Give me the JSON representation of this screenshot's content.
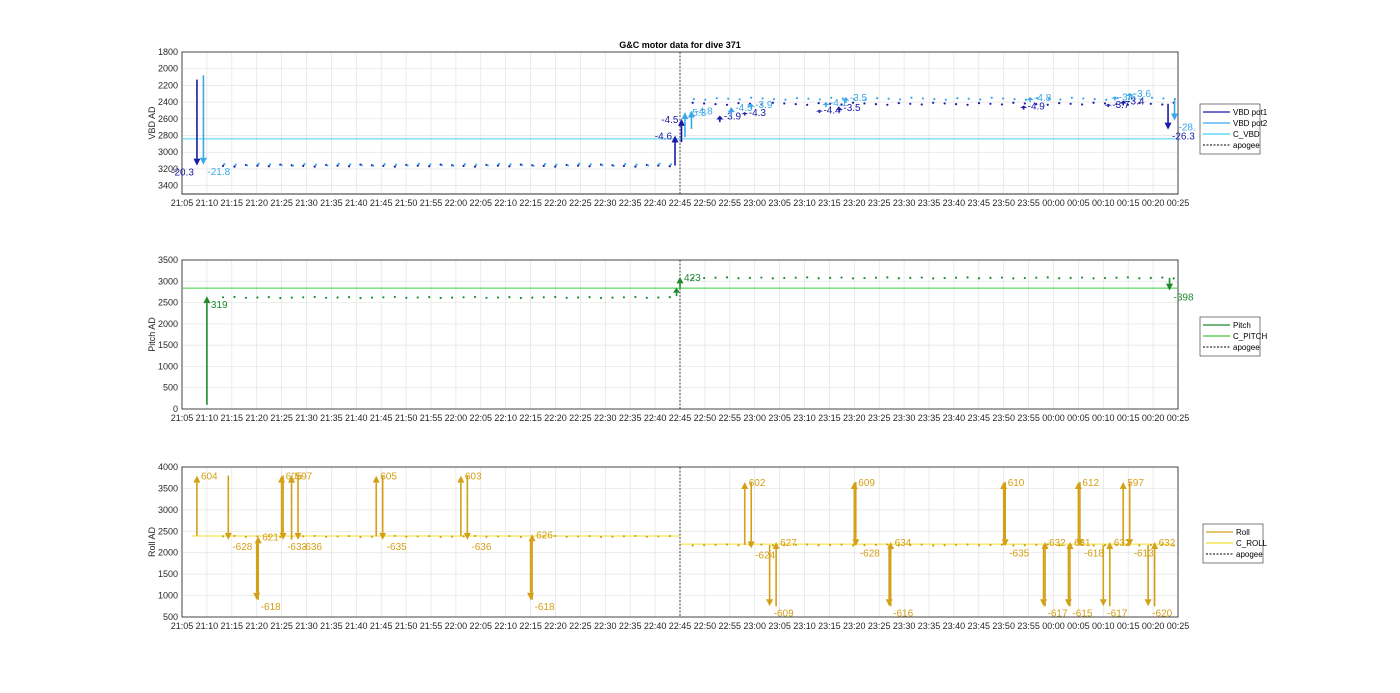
{
  "colors": {
    "vbd1": "#1a1aa6",
    "vbd2": "#38a8e8",
    "cvbd": "#45d0f0",
    "pitch": "#1e8a2e",
    "cpitch": "#3dcc3d",
    "roll": "#d4a017",
    "croll": "#f0e030",
    "apogee": "#333333"
  },
  "chart_data": [
    {
      "type": "scatter",
      "title": "G&C motor data for dive 371",
      "ylabel": "VBD AD",
      "y_reversed": true,
      "ylim": [
        1800,
        3500
      ],
      "yticks": [
        "1800",
        "2000",
        "2200",
        "2400",
        "2600",
        "2800",
        "3000",
        "3200",
        "3400"
      ],
      "xlim": [
        "21:05",
        "00:25"
      ],
      "xticks": [
        "21:05",
        "21:10",
        "21:15",
        "21:20",
        "21:25",
        "21:30",
        "21:35",
        "21:40",
        "21:45",
        "21:50",
        "21:55",
        "22:00",
        "22:05",
        "22:10",
        "22:15",
        "22:20",
        "22:25",
        "22:30",
        "22:35",
        "22:40",
        "22:45",
        "22:50",
        "22:55",
        "23:00",
        "23:05",
        "23:10",
        "23:15",
        "23:20",
        "23:25",
        "23:30",
        "23:35",
        "23:40",
        "23:45",
        "23:50",
        "23:55",
        "00:00",
        "00:05",
        "00:10",
        "00:15",
        "00:20",
        "00:25"
      ],
      "grid": true,
      "legend": {
        "position": "outside-right",
        "entries": [
          "VBD pot1",
          "VBD pot2",
          "C_VBD",
          "apogee"
        ]
      },
      "apogee": "22:45",
      "series": [
        {
          "name": "C_VBD",
          "kind": "hline",
          "y": 2840
        },
        {
          "name": "VBD pot1",
          "kind": "points",
          "base_dive": 3160,
          "base_climb": 2420
        },
        {
          "name": "VBD pot2",
          "kind": "points",
          "base_dive": 3150,
          "base_climb": 2360
        }
      ],
      "arrows": [
        {
          "t": "21:08",
          "y0": 2130,
          "y1": 3160,
          "color": "vbd1",
          "label": "-20.3"
        },
        {
          "t": "21:09",
          "y0": 2080,
          "y1": 3150,
          "color": "vbd2",
          "label": "-21.8"
        },
        {
          "t": "22:44",
          "y0": 3160,
          "y1": 2800,
          "color": "vbd1",
          "label": "-4.6"
        },
        {
          "t": "22:45",
          "y0": 2880,
          "y1": 2600,
          "color": "vbd1",
          "label": "-4.5"
        },
        {
          "t": "22:46",
          "y0": 2820,
          "y1": 2520,
          "color": "vbd2",
          "label": "-5.3"
        },
        {
          "t": "22:47",
          "y0": 2720,
          "y1": 2500,
          "color": "vbd2",
          "label": "-4.8"
        },
        {
          "t": "22:53",
          "y0": 2640,
          "y1": 2560,
          "color": "vbd1",
          "label": "-3.9"
        },
        {
          "t": "22:55",
          "y0": 2560,
          "y1": 2460,
          "color": "vbd2",
          "label": "-4.5"
        },
        {
          "t": "22:58",
          "y0": 2560,
          "y1": 2520,
          "color": "vbd1",
          "label": "-4.3"
        },
        {
          "t": "22:59",
          "y0": 2480,
          "y1": 2420,
          "color": "vbd2",
          "label": "-3.9"
        },
        {
          "t": "23:13",
          "y0": 2530,
          "y1": 2490,
          "color": "vbd1",
          "label": "-4.4"
        },
        {
          "t": "23:14",
          "y0": 2460,
          "y1": 2400,
          "color": "vbd2",
          "label": "-4.1"
        },
        {
          "t": "23:17",
          "y0": 2520,
          "y1": 2460,
          "color": "vbd1",
          "label": "-3.5"
        },
        {
          "t": "23:18",
          "y0": 2410,
          "y1": 2340,
          "color": "vbd2",
          "label": "-3.5"
        },
        {
          "t": "23:54",
          "y0": 2490,
          "y1": 2440,
          "color": "vbd1",
          "label": "-4.9"
        },
        {
          "t": "23:55",
          "y0": 2400,
          "y1": 2340,
          "color": "vbd2",
          "label": "-4.8"
        },
        {
          "t": "00:11",
          "y0": 2460,
          "y1": 2420,
          "color": "vbd1",
          "label": "-3.7"
        },
        {
          "t": "00:12",
          "y0": 2380,
          "y1": 2330,
          "color": "vbd2",
          "label": "-3.6"
        },
        {
          "t": "00:14",
          "y0": 2440,
          "y1": 2380,
          "color": "vbd1",
          "label": "-3.4"
        },
        {
          "t": "00:15",
          "y0": 2350,
          "y1": 2290,
          "color": "vbd2",
          "label": "-3.6"
        },
        {
          "t": "00:23",
          "y0": 2420,
          "y1": 2730,
          "color": "vbd1",
          "label": "-26.3"
        },
        {
          "t": "00:24",
          "y0": 2380,
          "y1": 2620,
          "color": "vbd2",
          "label": "-28."
        }
      ]
    },
    {
      "type": "scatter",
      "ylabel": "Pitch AD",
      "ylim": [
        0,
        3500
      ],
      "yticks": [
        "0",
        "500",
        "1000",
        "1500",
        "2000",
        "2500",
        "3000",
        "3500"
      ],
      "xlim": [
        "21:05",
        "00:25"
      ],
      "grid": true,
      "legend": {
        "position": "outside-right",
        "entries": [
          "Pitch",
          "C_PITCH",
          "apogee"
        ]
      },
      "apogee": "22:45",
      "series": [
        {
          "name": "C_PITCH",
          "kind": "hline",
          "y": 2840
        },
        {
          "name": "Pitch",
          "kind": "points",
          "base_dive": 2620,
          "base_climb": 3080
        }
      ],
      "arrows": [
        {
          "t": "21:10",
          "y0": 100,
          "y1": 2650,
          "color": "pitch",
          "label": "319"
        },
        {
          "t": "22:44",
          "y0": 2650,
          "y1": 2850,
          "color": "pitch",
          "label": ""
        },
        {
          "t": "22:45",
          "y0": 2850,
          "y1": 3100,
          "color": "pitch",
          "label": "423"
        },
        {
          "t": "00:23",
          "y0": 3080,
          "y1": 2780,
          "color": "pitch",
          "label": "-398"
        }
      ]
    },
    {
      "type": "scatter",
      "ylabel": "Roll AD",
      "ylim": [
        500,
        4000
      ],
      "yticks": [
        "500",
        "1000",
        "1500",
        "2000",
        "2500",
        "3000",
        "3500",
        "4000"
      ],
      "xlim": [
        "21:05",
        "00:25"
      ],
      "grid": true,
      "legend": {
        "position": "outside-right",
        "entries": [
          "Roll",
          "C_ROLL",
          "apogee"
        ]
      },
      "apogee": "22:45",
      "series": [
        {
          "name": "C_ROLL",
          "kind": "hline_split",
          "y_dive": 2390,
          "y_climb": 2200
        },
        {
          "name": "Roll",
          "kind": "points",
          "base_dive": 2380,
          "base_climb": 2180
        }
      ],
      "arrows": [
        {
          "t": "21:08",
          "y0": 2400,
          "y1": 3800,
          "color": "roll",
          "label": "604"
        },
        {
          "t": "21:14",
          "y0": 3800,
          "y1": 2300,
          "color": "roll",
          "label": "-628"
        },
        {
          "t": "21:20",
          "y0": 2300,
          "y1": 900,
          "color": "roll",
          "label": "-618"
        },
        {
          "t": "21:20",
          "y0": 900,
          "y1": 2380,
          "color": "roll",
          "label": "621"
        },
        {
          "t": "21:25",
          "y0": 2380,
          "y1": 3800,
          "color": "roll",
          "label": "605"
        },
        {
          "t": "21:25",
          "y0": 3800,
          "y1": 2300,
          "color": "roll",
          "label": "-633"
        },
        {
          "t": "21:27",
          "y0": 2300,
          "y1": 3800,
          "color": "roll",
          "label": "597"
        },
        {
          "t": "21:28",
          "y0": 3800,
          "y1": 2300,
          "color": "roll",
          "label": "-636"
        },
        {
          "t": "21:44",
          "y0": 2380,
          "y1": 3800,
          "color": "roll",
          "label": "605"
        },
        {
          "t": "21:45",
          "y0": 3800,
          "y1": 2300,
          "color": "roll",
          "label": "-635"
        },
        {
          "t": "22:01",
          "y0": 2380,
          "y1": 3800,
          "color": "roll",
          "label": "603"
        },
        {
          "t": "22:02",
          "y0": 3800,
          "y1": 2300,
          "color": "roll",
          "label": "-636"
        },
        {
          "t": "22:15",
          "y0": 2300,
          "y1": 900,
          "color": "roll",
          "label": "-618"
        },
        {
          "t": "22:15",
          "y0": 900,
          "y1": 2430,
          "color": "roll",
          "label": "626"
        },
        {
          "t": "22:58",
          "y0": 2180,
          "y1": 3650,
          "color": "roll",
          "label": "602"
        },
        {
          "t": "22:59",
          "y0": 3650,
          "y1": 2100,
          "color": "roll",
          "label": "-624"
        },
        {
          "t": "23:03",
          "y0": 2180,
          "y1": 750,
          "color": "roll",
          "label": "-609"
        },
        {
          "t": "23:04",
          "y0": 750,
          "y1": 2250,
          "color": "roll",
          "label": "627"
        },
        {
          "t": "23:20",
          "y0": 2180,
          "y1": 3650,
          "color": "roll",
          "label": "609"
        },
        {
          "t": "23:20",
          "y0": 3650,
          "y1": 2150,
          "color": "roll",
          "label": "-628"
        },
        {
          "t": "23:27",
          "y0": 2180,
          "y1": 750,
          "color": "roll",
          "label": "-616"
        },
        {
          "t": "23:27",
          "y0": 750,
          "y1": 2250,
          "color": "roll",
          "label": "634"
        },
        {
          "t": "23:50",
          "y0": 2180,
          "y1": 3650,
          "color": "roll",
          "label": "610"
        },
        {
          "t": "23:50",
          "y0": 3650,
          "y1": 2150,
          "color": "roll",
          "label": "-635"
        },
        {
          "t": "23:58",
          "y0": 2180,
          "y1": 750,
          "color": "roll",
          "label": "-617"
        },
        {
          "t": "23:58",
          "y0": 750,
          "y1": 2250,
          "color": "roll",
          "label": "632"
        },
        {
          "t": "00:03",
          "y0": 2180,
          "y1": 750,
          "color": "roll",
          "label": "-615"
        },
        {
          "t": "00:03",
          "y0": 750,
          "y1": 2250,
          "color": "roll",
          "label": "631"
        },
        {
          "t": "00:05",
          "y0": 2180,
          "y1": 3650,
          "color": "roll",
          "label": "612"
        },
        {
          "t": "00:05",
          "y0": 3650,
          "y1": 2150,
          "color": "roll",
          "label": "-618"
        },
        {
          "t": "00:10",
          "y0": 2180,
          "y1": 750,
          "color": "roll",
          "label": "-617"
        },
        {
          "t": "00:11",
          "y0": 750,
          "y1": 2250,
          "color": "roll",
          "label": "632"
        },
        {
          "t": "00:14",
          "y0": 2180,
          "y1": 3650,
          "color": "roll",
          "label": "597"
        },
        {
          "t": "00:15",
          "y0": 3650,
          "y1": 2150,
          "color": "roll",
          "label": "-613"
        },
        {
          "t": "00:19",
          "y0": 2180,
          "y1": 750,
          "color": "roll",
          "label": "-620"
        },
        {
          "t": "00:20",
          "y0": 750,
          "y1": 2250,
          "color": "roll",
          "label": "632"
        }
      ]
    }
  ]
}
